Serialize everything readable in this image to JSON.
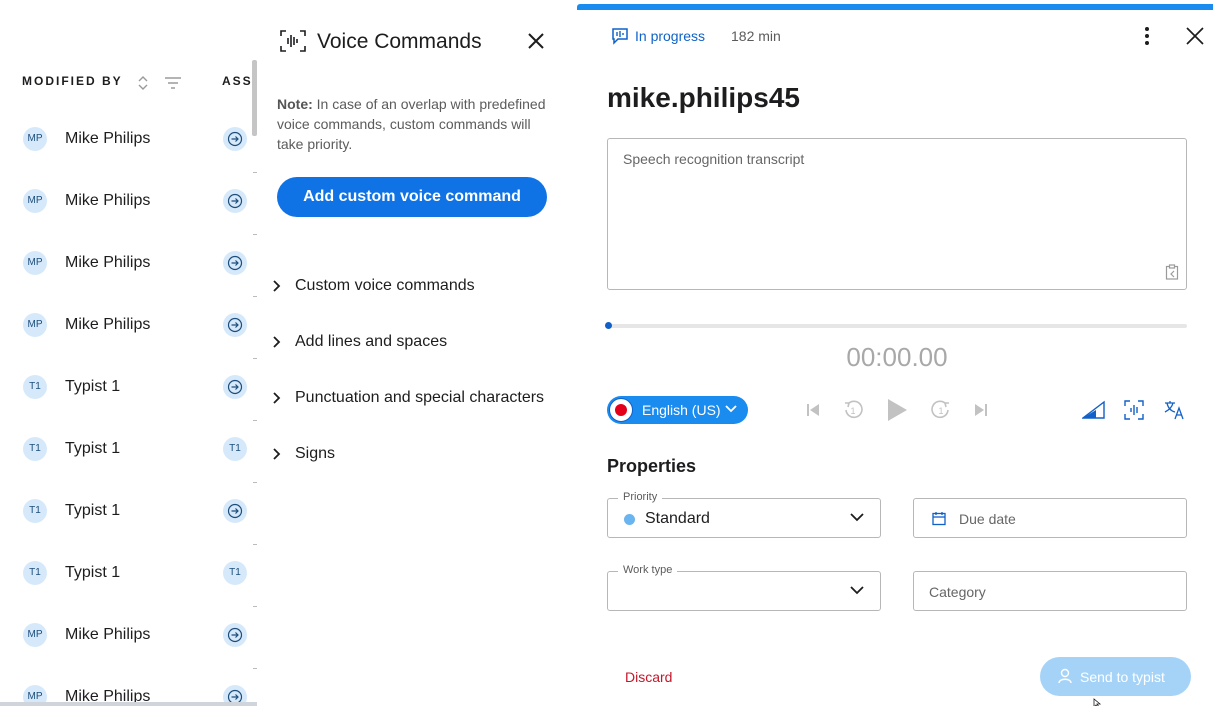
{
  "list": {
    "headers": {
      "modified_by": "MODIFIED BY",
      "assignee": "ASSI"
    },
    "rows": [
      {
        "initials": "MP",
        "name": "Mike Philips",
        "assignee_initials": ""
      },
      {
        "initials": "MP",
        "name": "Mike Philips",
        "assignee_initials": ""
      },
      {
        "initials": "MP",
        "name": "Mike Philips",
        "assignee_initials": ""
      },
      {
        "initials": "MP",
        "name": "Mike Philips",
        "assignee_initials": ""
      },
      {
        "initials": "T1",
        "name": "Typist 1",
        "assignee_initials": ""
      },
      {
        "initials": "T1",
        "name": "Typist 1",
        "assignee_initials": "T1"
      },
      {
        "initials": "T1",
        "name": "Typist 1",
        "assignee_initials": ""
      },
      {
        "initials": "T1",
        "name": "Typist 1",
        "assignee_initials": "T1"
      },
      {
        "initials": "MP",
        "name": "Mike Philips",
        "assignee_initials": ""
      },
      {
        "initials": "MP",
        "name": "Mike Philips",
        "assignee_initials": ""
      }
    ]
  },
  "voice_panel": {
    "title": "Voice Commands",
    "note_label": "Note:",
    "note_text": " In case of an overlap with predefined voice commands, custom commands will take priority.",
    "add_button": "Add custom voice command",
    "sections": [
      {
        "label": "Custom voice commands"
      },
      {
        "label": "Add lines and spaces"
      },
      {
        "label": "Punctuation and special characters"
      },
      {
        "label": "Signs"
      }
    ]
  },
  "detail": {
    "status": "In progress",
    "duration": "182 min",
    "title": "mike.philips45",
    "transcript_placeholder": "Speech recognition transcript",
    "timecode": "00:00.00",
    "playback_progress": 0,
    "language": "English (US)",
    "properties_title": "Properties",
    "priority": {
      "legend": "Priority",
      "value": "Standard",
      "dot_color": "#6ab4f0"
    },
    "due_date": {
      "placeholder": "Due date"
    },
    "work_type": {
      "legend": "Work type",
      "value": ""
    },
    "category": {
      "placeholder": "Category"
    },
    "discard": "Discard",
    "send": "Send to typist"
  },
  "colors": {
    "accent": "#0f73e6",
    "accent_light": "#1a8cf0",
    "status_text": "#0f62c7",
    "discard": "#c5162a",
    "send_disabled": "#a5d3f8",
    "avatar_bg": "#d6e9fb"
  },
  "icons": {
    "status": "speech-bubble-icon",
    "title": "voice-waveform-icon",
    "paste": "paste-clipboard-icon"
  }
}
